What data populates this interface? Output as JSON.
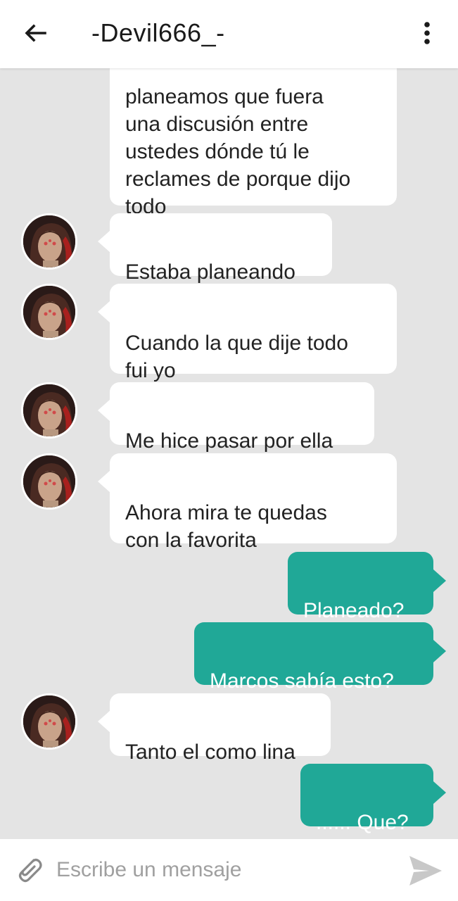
{
  "header": {
    "title": "-Devil666_-",
    "back_icon": "arrow-left-icon",
    "menu_icon": "more-vertical-icon"
  },
  "messages": [
    {
      "from": "them",
      "text": "planeamos que fuera\nuna discusión entre\nustedes dónde tú le\nreclames de porque dijo\ntodo"
    },
    {
      "from": "them",
      "text": "Estaba planeando"
    },
    {
      "from": "them",
      "text": "Cuando la que dije todo\nfui yo"
    },
    {
      "from": "them",
      "text": "Me hice pasar por ella"
    },
    {
      "from": "them",
      "text": "Ahora mira te quedas\ncon la favorita"
    },
    {
      "from": "me",
      "text": "Planeado?"
    },
    {
      "from": "me",
      "text": "Marcos sabía esto?"
    },
    {
      "from": "them",
      "text": "Tanto el como lina"
    },
    {
      "from": "me",
      "text": "...... Que?"
    }
  ],
  "composer": {
    "placeholder": "Escribe un mensaje",
    "value": "",
    "attach_icon": "paperclip-icon",
    "send_icon": "send-icon"
  },
  "colors": {
    "chat_background": "#e4e4e4",
    "incoming_bubble": "#ffffff",
    "outgoing_bubble": "#20a897",
    "header_background": "#ffffff"
  }
}
